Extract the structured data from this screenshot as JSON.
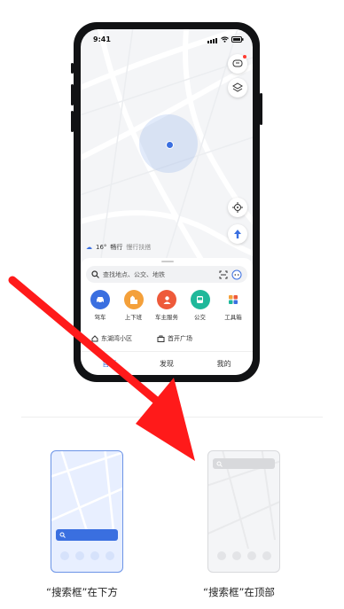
{
  "status": {
    "time": "9:41"
  },
  "weather": {
    "text": "16°",
    "traffic": "畅行",
    "note": "慢行扶搭"
  },
  "search": {
    "placeholder": "查找地点、公交、地铁"
  },
  "shortcuts": [
    {
      "label": "驾车",
      "color": "#3a6fe0",
      "icon": "car-icon"
    },
    {
      "label": "上下班",
      "color": "#f4a03a",
      "icon": "commute-icon"
    },
    {
      "label": "车主服务",
      "color": "#ee5a3a",
      "icon": "car-owner-icon"
    },
    {
      "label": "公交",
      "color": "#1fb89a",
      "icon": "bus-icon"
    },
    {
      "label": "工具箱",
      "color": "#ffffff",
      "icon": "toolbox-icon"
    }
  ],
  "places": [
    {
      "label": "东湖湾小区",
      "icon": "home-icon"
    },
    {
      "label": "首开广场",
      "icon": "office-icon"
    }
  ],
  "tabs": [
    {
      "label": "首页",
      "active": true
    },
    {
      "label": "发现",
      "active": false
    },
    {
      "label": "我的",
      "active": false
    }
  ],
  "captions": {
    "bottom": "“搜索框”在下方",
    "top": "“搜索框”在顶部"
  },
  "colors": {
    "accent": "#3a6fe0",
    "arrow": "#ff1a1a"
  }
}
